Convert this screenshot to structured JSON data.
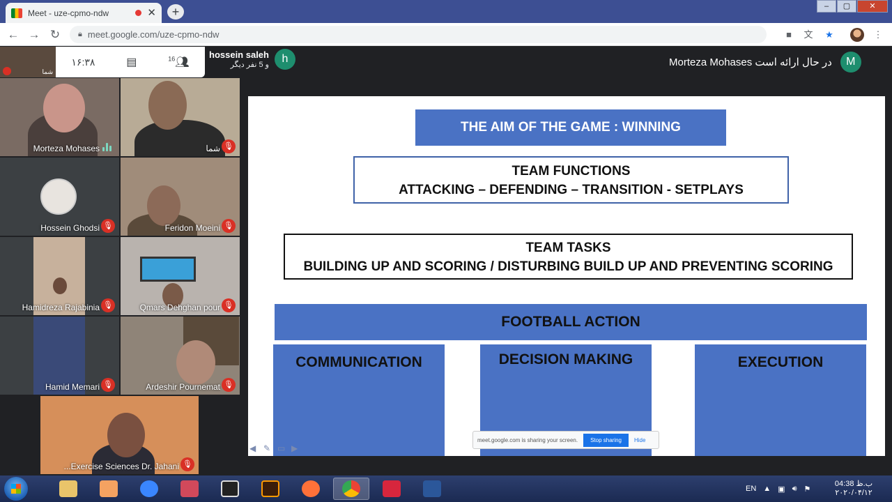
{
  "browser": {
    "tab_title": "Meet - uze-cpmo-ndw",
    "tab_close": "✕",
    "new_tab": "+",
    "url": "meet.google.com/uze-cpmo-ndw",
    "window_controls": [
      "‒",
      "▢",
      "✕"
    ]
  },
  "meet": {
    "self_label": "شما",
    "clock": "۱۶:۳۸",
    "participant_count": "16",
    "chip": {
      "name": "hossein saleh",
      "sub": "و 5 نفر دیگر",
      "initial": "h",
      "color": "#1e8e6e"
    },
    "banner": {
      "text": "Morteza Mohases در حال ارائه است",
      "initial": "M",
      "color": "#1e8e6e"
    }
  },
  "participants": [
    {
      "name": "Morteza Mohases",
      "speaking": true
    },
    {
      "name": "شما",
      "speaking": false
    },
    {
      "name": "Hossein Ghodsi",
      "speaking": false
    },
    {
      "name": "Feridon Moeini",
      "speaking": false
    },
    {
      "name": "Hamidreza Rajabinia",
      "speaking": false
    },
    {
      "name": "Qmars Dehghan pour",
      "speaking": false
    },
    {
      "name": "Hamid Memari",
      "speaking": false
    },
    {
      "name": "Ardeshir Pournemat",
      "speaking": false
    },
    {
      "name": "...Exercise Sciences Dr. Jahani",
      "speaking": false
    }
  ],
  "slide": {
    "aim": "THE AIM OF THE GAME  :    WINNING",
    "functions_title": "TEAM FUNCTIONS",
    "functions_list": "ATTACKING – DEFENDING – TRANSITION - SETPLAYS",
    "tasks_title": "TEAM TASKS",
    "tasks_list": "BUILDING UP AND SCORING /   DISTURBING BUILD UP AND PREVENTING SCORING",
    "football_action": "FOOTBALL ACTION",
    "columns": [
      "COMMUNICATION",
      "DECISION MAKING",
      "EXECUTION"
    ],
    "share_notice": "meet.google.com is sharing your screen.",
    "stop_sharing": "Stop sharing",
    "hide": "Hide"
  },
  "taskbar": {
    "lang": "EN",
    "time": "04:38 ب.ظ",
    "date": "۲۰۲۰/۰۴/۱۲",
    "apps": [
      "explorer",
      "media-player",
      "internet-explorer",
      "powerpoint-viewer",
      "app-321",
      "illustrator",
      "firefox",
      "chrome",
      "acrobat",
      "word"
    ]
  }
}
